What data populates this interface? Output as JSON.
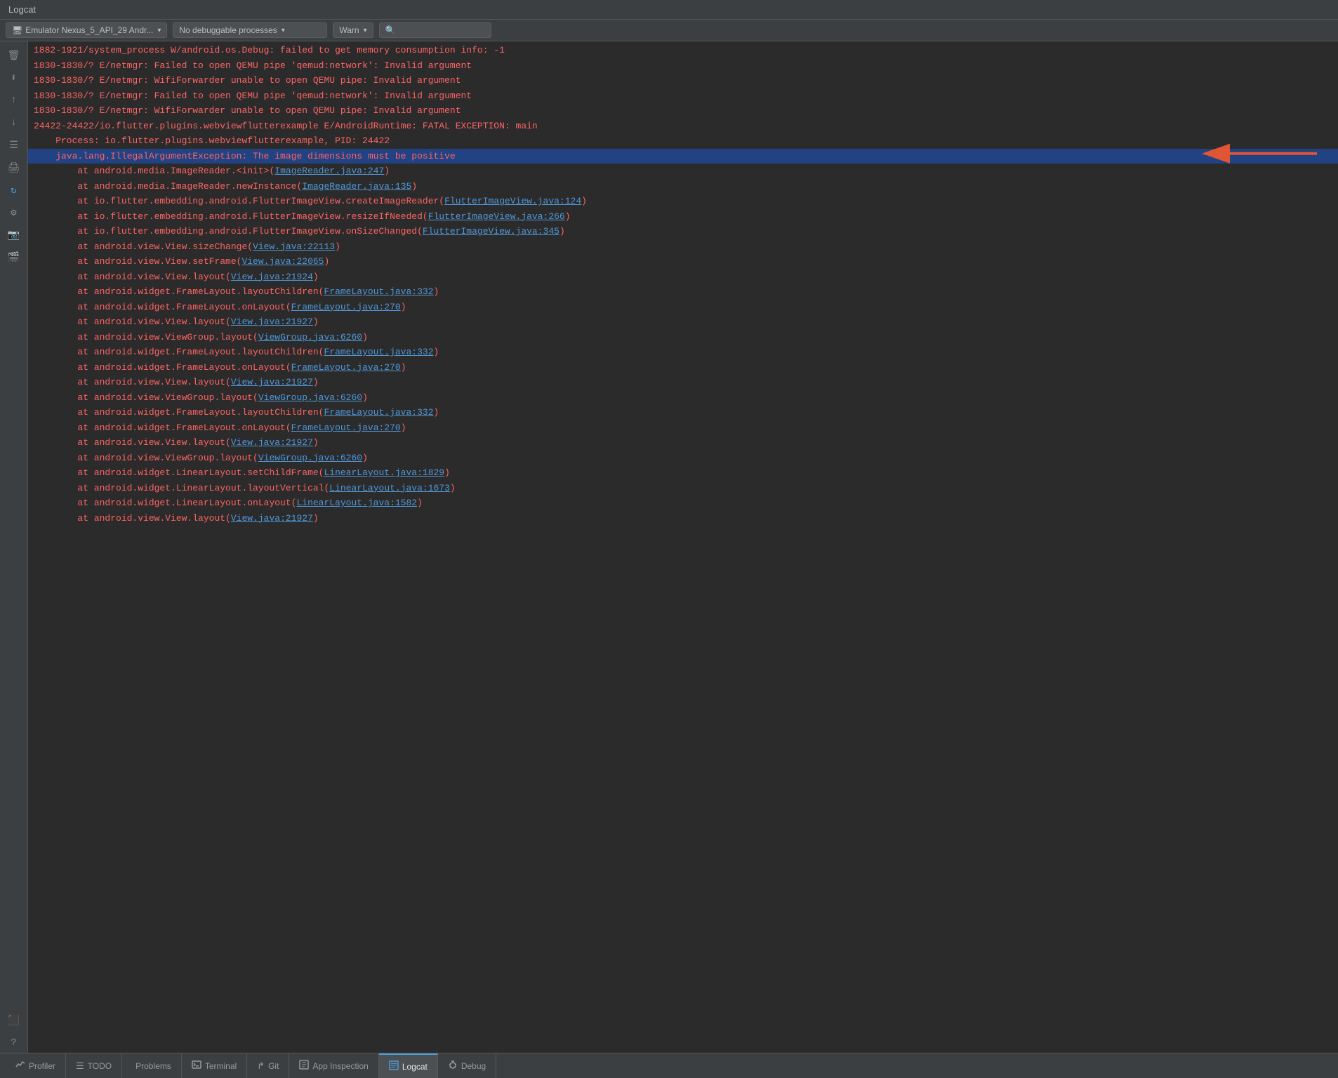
{
  "titleBar": {
    "title": "Logcat"
  },
  "toolbar": {
    "deviceLabel": "Emulator Nexus_5_API_29 Andr...",
    "processLabel": "No debuggable processes",
    "levelLabel": "Warn",
    "searchPlaceholder": "🔍"
  },
  "sidebar": {
    "icons": [
      {
        "name": "clear-icon",
        "symbol": "🗑",
        "title": "Clear"
      },
      {
        "name": "scroll-end-icon",
        "symbol": "⬇",
        "title": "Scroll to end"
      },
      {
        "name": "scroll-up-icon",
        "symbol": "↑",
        "title": "Scroll up"
      },
      {
        "name": "scroll-down-icon",
        "symbol": "↓",
        "title": "Scroll down"
      },
      {
        "name": "filter-icon",
        "symbol": "☰",
        "title": "Filter"
      },
      {
        "name": "print-icon",
        "symbol": "🖨",
        "title": "Print"
      },
      {
        "name": "refresh-icon",
        "symbol": "↻",
        "title": "Restart"
      },
      {
        "name": "settings-icon",
        "symbol": "⚙",
        "title": "Settings"
      },
      {
        "name": "camera-icon",
        "symbol": "📷",
        "title": "Screenshot"
      },
      {
        "name": "video-icon",
        "symbol": "🎬",
        "title": "Record"
      },
      {
        "name": "stop-icon",
        "symbol": "⬛",
        "title": "Stop"
      },
      {
        "name": "help-icon",
        "symbol": "?",
        "title": "Help"
      }
    ]
  },
  "logLines": [
    {
      "id": 1,
      "text": "1882-1921/system_process W/android.os.Debug: failed to get memory consumption info: -1",
      "type": "error",
      "indent": 0
    },
    {
      "id": 2,
      "text": "1830-1830/? E/netmgr: Failed to open QEMU pipe 'qemud:network': Invalid argument",
      "type": "error",
      "indent": 0
    },
    {
      "id": 3,
      "text": "1830-1830/? E/netmgr: WifiForwarder unable to open QEMU pipe: Invalid argument",
      "type": "error",
      "indent": 0
    },
    {
      "id": 4,
      "text": "1830-1830/? E/netmgr: Failed to open QEMU pipe 'qemud:network': Invalid argument",
      "type": "error",
      "indent": 0
    },
    {
      "id": 5,
      "text": "1830-1830/? E/netmgr: WifiForwarder unable to open QEMU pipe: Invalid argument",
      "type": "error",
      "indent": 0
    },
    {
      "id": 6,
      "text": "24422-24422/io.flutter.plugins.webviewflutterexample E/AndroidRuntime: FATAL EXCEPTION: main",
      "type": "error",
      "indent": 0
    },
    {
      "id": 7,
      "text": "    Process: io.flutter.plugins.webviewflutterexample, PID: 24422",
      "type": "error",
      "indent": 1
    },
    {
      "id": 8,
      "text": "    java.lang.IllegalArgumentException: The image dimensions must be positive",
      "type": "highlight",
      "indent": 1
    },
    {
      "id": 9,
      "text": "        at android.media.ImageReader.<init>(ImageReader.java:247)",
      "type": "error",
      "indent": 2,
      "hasLink": true,
      "linkText": "ImageReader.java:247",
      "preLink": "        at android.media.ImageReader.<init>(",
      "postLink": ")"
    },
    {
      "id": 10,
      "text": "        at android.media.ImageReader.newInstance(ImageReader.java:135)",
      "type": "error",
      "indent": 2,
      "hasLink": true,
      "linkText": "ImageReader.java:135",
      "preLink": "        at android.media.ImageReader.newInstance(",
      "postLink": ")"
    },
    {
      "id": 11,
      "text": "        at io.flutter.embedding.android.FlutterImageView.createImageReader(FlutterImageView.java:124)",
      "type": "error",
      "indent": 2,
      "hasLink": true,
      "linkText": "FlutterImageView.java:124",
      "preLink": "        at io.flutter.embedding.android.FlutterImageView.createImageReader(",
      "postLink": ")"
    },
    {
      "id": 12,
      "text": "        at io.flutter.embedding.android.FlutterImageView.resizeIfNeeded(FlutterImageView.java:266)",
      "type": "error",
      "indent": 2,
      "hasLink": true,
      "linkText": "FlutterImageView.java:266",
      "preLink": "        at io.flutter.embedding.android.FlutterImageView.resizeIfNeeded(",
      "postLink": ")"
    },
    {
      "id": 13,
      "text": "        at io.flutter.embedding.android.FlutterImageView.onSizeChanged(FlutterImageView.java:345)",
      "type": "error",
      "indent": 2,
      "hasLink": true,
      "linkText": "FlutterImageView.java:345",
      "preLink": "        at io.flutter.embedding.android.FlutterImageView.onSizeChanged(",
      "postLink": ")"
    },
    {
      "id": 14,
      "text": "        at android.view.View.sizeChange(View.java:22113)",
      "type": "error",
      "indent": 2,
      "hasLink": true,
      "linkText": "View.java:22113",
      "preLink": "        at android.view.View.sizeChange(",
      "postLink": ")"
    },
    {
      "id": 15,
      "text": "        at android.view.View.setFrame(View.java:22065)",
      "type": "error",
      "indent": 2,
      "hasLink": true,
      "linkText": "View.java:22065",
      "preLink": "        at android.view.View.setFrame(",
      "postLink": ")"
    },
    {
      "id": 16,
      "text": "        at android.view.View.layout(View.java:21924)",
      "type": "error",
      "indent": 2,
      "hasLink": true,
      "linkText": "View.java:21924",
      "preLink": "        at android.view.View.layout(",
      "postLink": ")"
    },
    {
      "id": 17,
      "text": "        at android.widget.FrameLayout.layoutChildren(FrameLayout.java:332)",
      "type": "error",
      "indent": 2,
      "hasLink": true,
      "linkText": "FrameLayout.java:332",
      "preLink": "        at android.widget.FrameLayout.layoutChildren(",
      "postLink": ")"
    },
    {
      "id": 18,
      "text": "        at android.widget.FrameLayout.onLayout(FrameLayout.java:270)",
      "type": "error",
      "indent": 2,
      "hasLink": true,
      "linkText": "FrameLayout.java:270",
      "preLink": "        at android.widget.FrameLayout.onLayout(",
      "postLink": ")"
    },
    {
      "id": 19,
      "text": "        at android.view.View.layout(View.java:21927)",
      "type": "error",
      "indent": 2,
      "hasLink": true,
      "linkText": "View.java:21927",
      "preLink": "        at android.view.View.layout(",
      "postLink": ")"
    },
    {
      "id": 20,
      "text": "        at android.view.ViewGroup.layout(ViewGroup.java:6260)",
      "type": "error",
      "indent": 2,
      "hasLink": true,
      "linkText": "ViewGroup.java:6260",
      "preLink": "        at android.view.ViewGroup.layout(",
      "postLink": ")"
    },
    {
      "id": 21,
      "text": "        at android.widget.FrameLayout.layoutChildren(FrameLayout.java:332)",
      "type": "error",
      "indent": 2,
      "hasLink": true,
      "linkText": "FrameLayout.java:332",
      "preLink": "        at android.widget.FrameLayout.layoutChildren(",
      "postLink": ")"
    },
    {
      "id": 22,
      "text": "        at android.widget.FrameLayout.onLayout(FrameLayout.java:270)",
      "type": "error",
      "indent": 2,
      "hasLink": true,
      "linkText": "FrameLayout.java:270",
      "preLink": "        at android.widget.FrameLayout.onLayout(",
      "postLink": ")"
    },
    {
      "id": 23,
      "text": "        at android.view.View.layout(View.java:21927)",
      "type": "error",
      "indent": 2,
      "hasLink": true,
      "linkText": "View.java:21927",
      "preLink": "        at android.view.View.layout(",
      "postLink": ")"
    },
    {
      "id": 24,
      "text": "        at android.view.ViewGroup.layout(ViewGroup.java:6260)",
      "type": "error",
      "indent": 2,
      "hasLink": true,
      "linkText": "ViewGroup.java:6260",
      "preLink": "        at android.view.ViewGroup.layout(",
      "postLink": ")"
    },
    {
      "id": 25,
      "text": "        at android.widget.FrameLayout.layoutChildren(FrameLayout.java:332)",
      "type": "error",
      "indent": 2,
      "hasLink": true,
      "linkText": "FrameLayout.java:332",
      "preLink": "        at android.widget.FrameLayout.layoutChildren(",
      "postLink": ")"
    },
    {
      "id": 26,
      "text": "        at android.widget.FrameLayout.onLayout(FrameLayout.java:270)",
      "type": "error",
      "indent": 2,
      "hasLink": true,
      "linkText": "FrameLayout.java:270",
      "preLink": "        at android.widget.FrameLayout.onLayout(",
      "postLink": ")"
    },
    {
      "id": 27,
      "text": "        at android.view.View.layout(View.java:21927)",
      "type": "error",
      "indent": 2,
      "hasLink": true,
      "linkText": "View.java:21927",
      "preLink": "        at android.view.View.layout(",
      "postLink": ")"
    },
    {
      "id": 28,
      "text": "        at android.view.ViewGroup.layout(ViewGroup.java:6260)",
      "type": "error",
      "indent": 2,
      "hasLink": true,
      "linkText": "ViewGroup.java:6260",
      "preLink": "        at android.view.ViewGroup.layout(",
      "postLink": ")"
    },
    {
      "id": 29,
      "text": "        at android.widget.LinearLayout.setChildFrame(LinearLayout.java:1829)",
      "type": "error",
      "indent": 2,
      "hasLink": true,
      "linkText": "LinearLayout.java:1829",
      "preLink": "        at android.widget.LinearLayout.setChildFrame(",
      "postLink": ")"
    },
    {
      "id": 30,
      "text": "        at android.widget.LinearLayout.layoutVertical(LinearLayout.java:1673)",
      "type": "error",
      "indent": 2,
      "hasLink": true,
      "linkText": "LinearLayout.java:1673",
      "preLink": "        at android.widget.LinearLayout.layoutVertical(",
      "postLink": ")"
    },
    {
      "id": 31,
      "text": "        at android.widget.LinearLayout.onLayout(LinearLayout.java:1582)",
      "type": "error",
      "indent": 2,
      "hasLink": true,
      "linkText": "LinearLayout.java:1582",
      "preLink": "        at android.widget.LinearLayout.onLayout(",
      "postLink": ")"
    },
    {
      "id": 32,
      "text": "        at android.view.View.layout(View.java:21927)",
      "type": "error",
      "indent": 2,
      "hasLink": true,
      "linkText": "View.java:21927",
      "preLink": "        at android.view.View.layout(",
      "postLink": ")"
    }
  ],
  "statusBar": {
    "tabs": [
      {
        "name": "profiler-tab",
        "label": "Profiler",
        "icon": "⚡",
        "iconType": "lightning",
        "active": false
      },
      {
        "name": "todo-tab",
        "label": "TODO",
        "icon": "☰",
        "iconType": "list",
        "active": false
      },
      {
        "name": "problems-tab",
        "label": "Problems",
        "icon": "●",
        "iconType": "dot-red",
        "active": false,
        "hasDot": true
      },
      {
        "name": "terminal-tab",
        "label": "Terminal",
        "icon": "▭",
        "iconType": "terminal",
        "active": false
      },
      {
        "name": "git-tab",
        "label": "Git",
        "icon": "↱",
        "iconType": "git",
        "active": false
      },
      {
        "name": "app-inspection-tab",
        "label": "App Inspection",
        "icon": "🔍",
        "iconType": "inspect",
        "active": false
      },
      {
        "name": "logcat-tab",
        "label": "Logcat",
        "icon": "≡",
        "iconType": "logcat",
        "active": true
      },
      {
        "name": "debug-tab",
        "label": "Debug",
        "icon": "🐛",
        "iconType": "bug",
        "active": false
      }
    ]
  }
}
